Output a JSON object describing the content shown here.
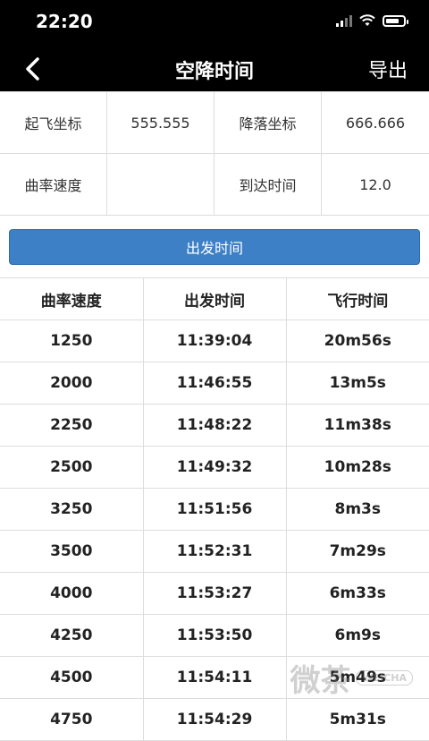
{
  "status_bar": {
    "time": "22:20"
  },
  "nav": {
    "title": "空降时间",
    "export_label": "导出",
    "back_icon": "chevron-left-icon"
  },
  "info": {
    "takeoff_label": "起飞坐标",
    "takeoff_value": "555.555",
    "landing_label": "降落坐标",
    "landing_value": "666.666",
    "curve_speed_label": "曲率速度",
    "curve_speed_value": "",
    "arrival_label": "到达时间",
    "arrival_value": "12.0"
  },
  "depart_button": {
    "label": "出发时间"
  },
  "table": {
    "headers": [
      "曲率速度",
      "出发时间",
      "飞行时间"
    ],
    "rows": [
      [
        "1250",
        "11:39:04",
        "20m56s"
      ],
      [
        "2000",
        "11:46:55",
        "13m5s"
      ],
      [
        "2250",
        "11:48:22",
        "11m38s"
      ],
      [
        "2500",
        "11:49:32",
        "10m28s"
      ],
      [
        "3250",
        "11:51:56",
        "8m3s"
      ],
      [
        "3500",
        "11:52:31",
        "7m29s"
      ],
      [
        "4000",
        "11:53:27",
        "6m33s"
      ],
      [
        "4250",
        "11:53:50",
        "6m9s"
      ],
      [
        "4500",
        "11:54:11",
        "5m49s"
      ],
      [
        "4750",
        "11:54:29",
        "5m31s"
      ]
    ]
  },
  "watermark": {
    "main": "微茶",
    "sub": "WEICHA"
  },
  "colors": {
    "accent": "#3d80c6",
    "header_bg": "#000000"
  }
}
